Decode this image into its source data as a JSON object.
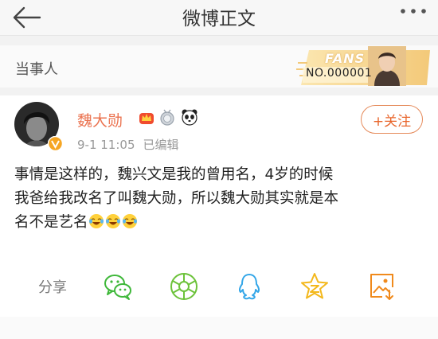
{
  "navbar": {
    "title": "微博正文"
  },
  "party": {
    "label": "当事人",
    "fans_badge": {
      "fans_text": "FANS",
      "number": "NO.000001"
    }
  },
  "post": {
    "user_name": "魏大勋",
    "time": "9-1 11:05",
    "edited": "已编辑",
    "follow_label": "+关注",
    "body_lines": [
      "事情是这样的，魏兴文是我的曾用名，4岁的时候",
      "我爸给我改名了叫魏大勋，所以魏大勋其实就是本",
      "名不是艺名"
    ]
  },
  "share": {
    "label": "分享"
  },
  "colors": {
    "accent": "#eb7350",
    "follow": "#e8662c",
    "wechat": "#3fb83a",
    "moments": "#6cc23a",
    "qq": "#33a6e8",
    "qzone": "#f3b81c",
    "weibo_share": "#f08a1c"
  }
}
